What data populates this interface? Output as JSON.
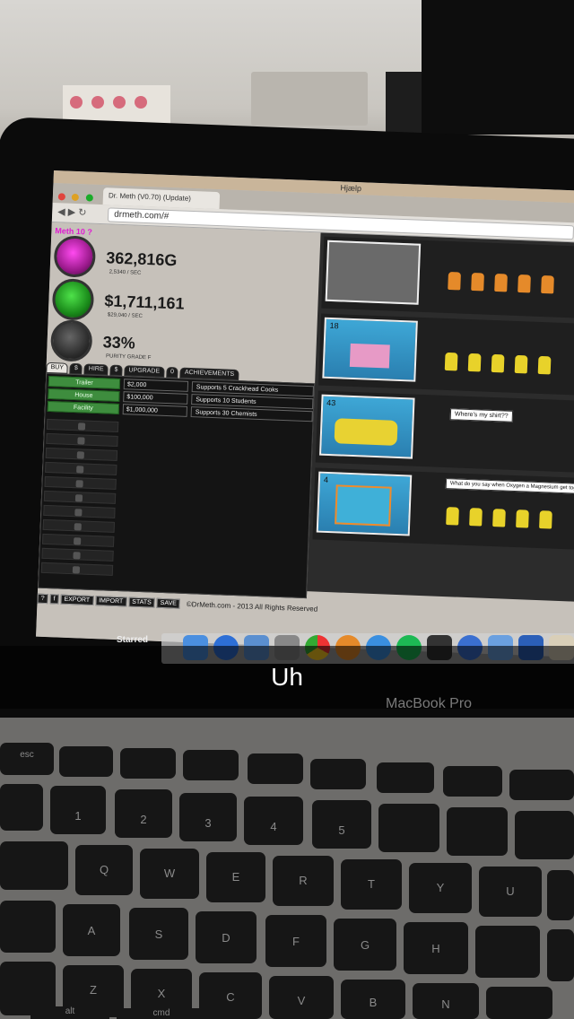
{
  "browser": {
    "menu_item": "Hjælp",
    "tab_title": "Dr. Meth (V0.70) (Update)",
    "url": "drmeth.com/#"
  },
  "stats": {
    "meth_level": "Meth 10 ?",
    "meth_amount": "362,816G",
    "meth_rate": "2,5340 / SEC",
    "cash_amount": "$1,711,161",
    "cash_rate": "$29,040 / SEC",
    "purity": "33%",
    "purity_grade": "PURITY GRADE F"
  },
  "tabs": [
    "BUY",
    "$",
    "HIRE",
    "$",
    "UPGRADE",
    "0",
    "ACHIEVEMENTS"
  ],
  "buy_rows": [
    {
      "label": "Trailer",
      "price": "$2,000",
      "desc": "Supports 5 Crackhead Cooks"
    },
    {
      "label": "House",
      "price": "$100,000",
      "desc": "Supports 10 Students"
    },
    {
      "label": "Facility",
      "price": "$1,000,000",
      "desc": "Supports 30 Chemists"
    }
  ],
  "locations": [
    {
      "count": ""
    },
    {
      "count": "18"
    },
    {
      "count": "43",
      "bubble": "Where's my shirt??"
    },
    {
      "count": "4",
      "bubble": "What do you say when Oxygen a Magnesium get together ... OMG"
    }
  ],
  "footer": {
    "export": "EXPORT",
    "import": "IMPORT",
    "stats": "STATS",
    "save": "SAVE",
    "copyright": "©DrMeth.com - 2013 All Rights Reserved"
  },
  "dock": {
    "starred": "Starred"
  },
  "laptop_label": "MacBook Pro",
  "caption": "Uh",
  "keys": {
    "esc": "esc",
    "one": "1",
    "two": "2",
    "three": "3",
    "four": "4",
    "five": "5",
    "q": "Q",
    "w": "W",
    "e": "E",
    "r": "R",
    "t": "T",
    "y": "Y",
    "u": "U",
    "a": "A",
    "s": "S",
    "d": "D",
    "f": "F",
    "g": "G",
    "h": "H",
    "z": "Z",
    "x": "X",
    "c": "C",
    "v": "V",
    "b": "B",
    "n": "N",
    "alt": "alt",
    "cmd": "cmd"
  },
  "colors": {
    "meth_orb": "#e01ad2",
    "cash_orb": "#2fbf2f",
    "buy_green": "#3e8d3e",
    "caption_bg": "#000000"
  }
}
